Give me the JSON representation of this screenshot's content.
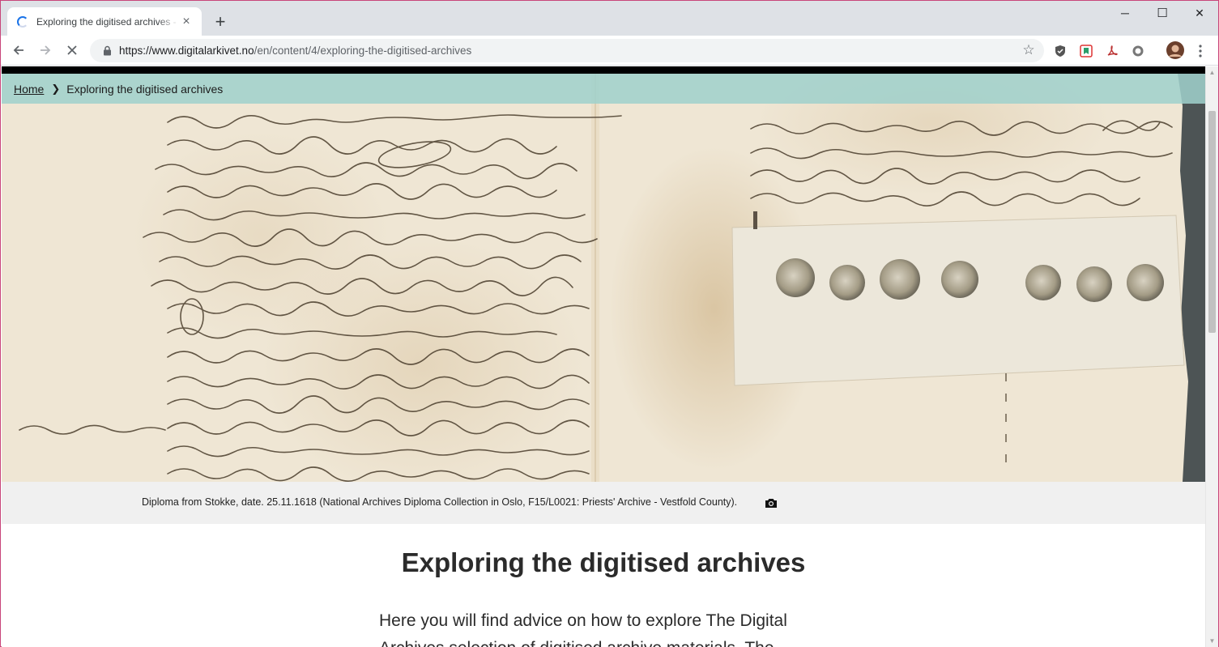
{
  "browser": {
    "tab_title": "Exploring the digitised archives - ",
    "tab_close": "×",
    "new_tab": "+",
    "window_controls": {
      "minimize": "─",
      "maximize": "☐",
      "close": "✕"
    },
    "url_host": "https://www.digitalarkivet.no",
    "url_path": "/en/content/4/exploring-the-digitised-archives",
    "icons": [
      "back-icon",
      "forward-icon",
      "stop-icon",
      "lock-icon",
      "star-icon",
      "shield-extension-icon",
      "bookmark-extension-icon",
      "pdf-extension-icon",
      "record-extension-icon",
      "profile-avatar",
      "menu-icon"
    ]
  },
  "breadcrumb": {
    "home": "Home",
    "current": "Exploring the digitised archives"
  },
  "hero": {
    "caption": "Diploma from Stokke, date. 25.11.1618 (National Archives Diploma Collection in Oslo, F15/L0021: Priests' Archive - Vestfold County)."
  },
  "article": {
    "title": "Exploring the digitised archives",
    "lead": "Here you will find advice on how to explore The Digital Archives selection of digitised archive materials. The"
  },
  "colors": {
    "breadcrumb_bg": "#a0d0cc",
    "tabstrip_bg": "#dee1e6",
    "caption_bg": "#f0f0f0",
    "parchment": "#efe6d4"
  }
}
